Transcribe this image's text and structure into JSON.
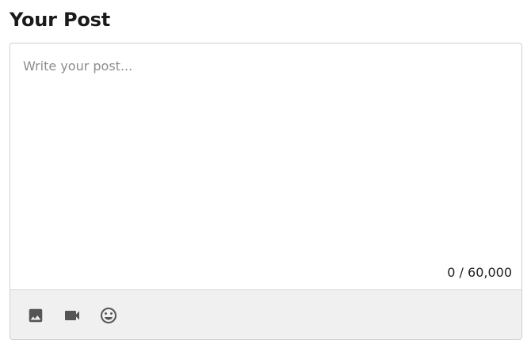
{
  "header": {
    "title": "Your Post"
  },
  "editor": {
    "value": "",
    "placeholder": "Write your post...",
    "char_count": "0 / 60,000"
  },
  "toolbar": {
    "items": [
      {
        "icon": "image-icon"
      },
      {
        "icon": "video-camera-icon"
      },
      {
        "icon": "emoji-icon"
      }
    ]
  },
  "colors": {
    "icon": "#555555",
    "toolbar_background": "#f0f0f0",
    "border": "#cfcfcf"
  }
}
